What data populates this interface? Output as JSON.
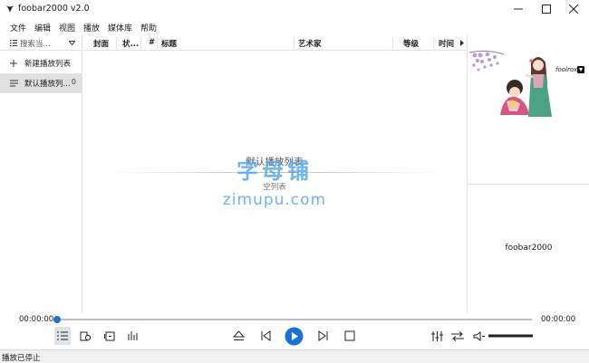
{
  "window": {
    "title": "foobar2000 v2.0"
  },
  "menu": [
    "文件",
    "编辑",
    "视图",
    "播放",
    "媒体库",
    "帮助"
  ],
  "sidebar": {
    "search_text": "搜索当...",
    "items": [
      {
        "label": "新建播放列表"
      },
      {
        "label": "默认播放列...",
        "count": "0"
      }
    ]
  },
  "playlist": {
    "columns": [
      "封面",
      "状...",
      "#",
      "标题",
      "艺术家",
      "等级",
      "时间"
    ],
    "title": "默认播放列表",
    "empty_text": "空列表",
    "watermark_cn": "字母铺",
    "watermark_url": "zimupu.com"
  },
  "right_panel": {
    "art_signature": "foolrox",
    "track_text": "foobar2000"
  },
  "seekbar": {
    "time_left": "00:00:00",
    "time_right": "00:00:00",
    "position": 0
  },
  "status": {
    "text": "播放已停止"
  },
  "colors": {
    "accent": "#1a73d1",
    "watermark": "#59a8e6"
  }
}
